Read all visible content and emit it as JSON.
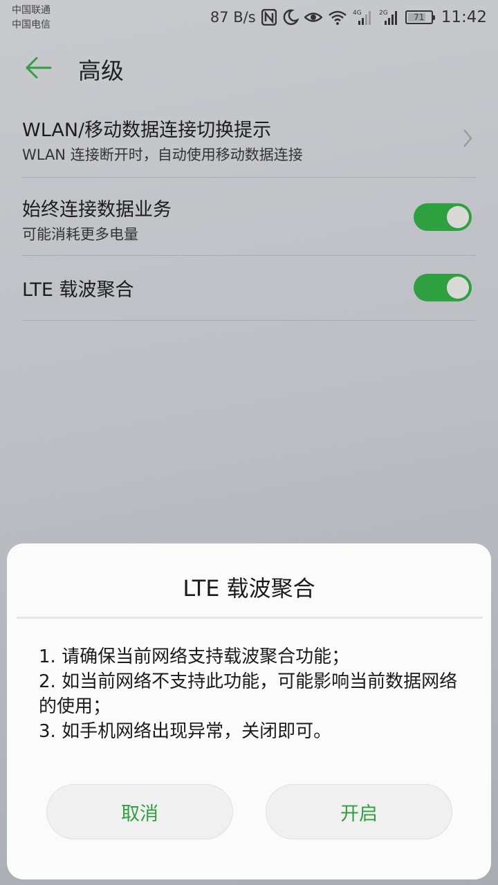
{
  "status_bar": {
    "carrier1": "中国联通",
    "carrier2": "中国电信",
    "net_speed": "87 B/s",
    "network1_type": "4G",
    "network2_type": "2G",
    "battery_level": "71",
    "time": "11:42",
    "icons": [
      "nfc-icon",
      "moon-icon",
      "eye-icon",
      "wifi-icon",
      "signal-icon",
      "signal-icon",
      "battery-icon"
    ]
  },
  "app_bar": {
    "title": "高级",
    "back_icon": "back-arrow-icon"
  },
  "settings": {
    "items": [
      {
        "title": "WLAN/移动数据连接切换提示",
        "subtitle": "WLAN 连接断开时，自动使用移动数据连接",
        "control": "chevron"
      },
      {
        "title": "始终连接数据业务",
        "subtitle": "可能消耗更多电量",
        "control": "toggle",
        "on": true
      },
      {
        "title": "LTE 载波聚合",
        "control": "toggle",
        "on": true
      }
    ]
  },
  "dialog": {
    "title": "LTE 载波聚合",
    "lines": [
      "1. 请确保当前网络支持载波聚合功能；",
      "2. 如当前网络不支持此功能，可能影响当前数据网络的使用；",
      "3. 如手机网络出现异常，关闭即可。"
    ],
    "cancel_label": "取消",
    "enable_label": "开启"
  },
  "colors": {
    "accent": "#2fa040",
    "dialog_bg": "#fbfbfb",
    "backdrop": "#bcbfc4"
  }
}
